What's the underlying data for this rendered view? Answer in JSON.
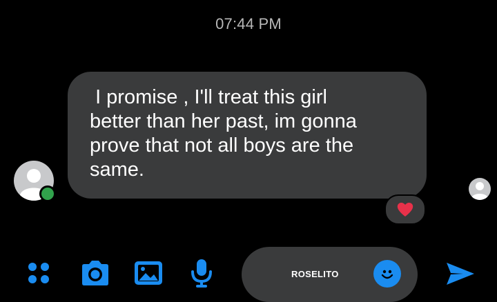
{
  "thread": {
    "timestamp": "07:44 PM"
  },
  "message": {
    "text": " I promise , I'll treat this girl\nbetter than her past, im gonna\nprove that not all boys are the\nsame.",
    "reaction": "heart",
    "sender_online": true
  },
  "composer": {
    "input_text": "ROSELITO"
  },
  "toolbar": {
    "icons": [
      "apps-icon",
      "camera-icon",
      "gallery-icon",
      "microphone-icon",
      "emoji-icon",
      "send-icon"
    ]
  },
  "colors": {
    "accent": "#1a8cf0",
    "bubble": "#3a3b3c",
    "online": "#31a24c",
    "heart": "#e8314a",
    "background": "#000000"
  }
}
